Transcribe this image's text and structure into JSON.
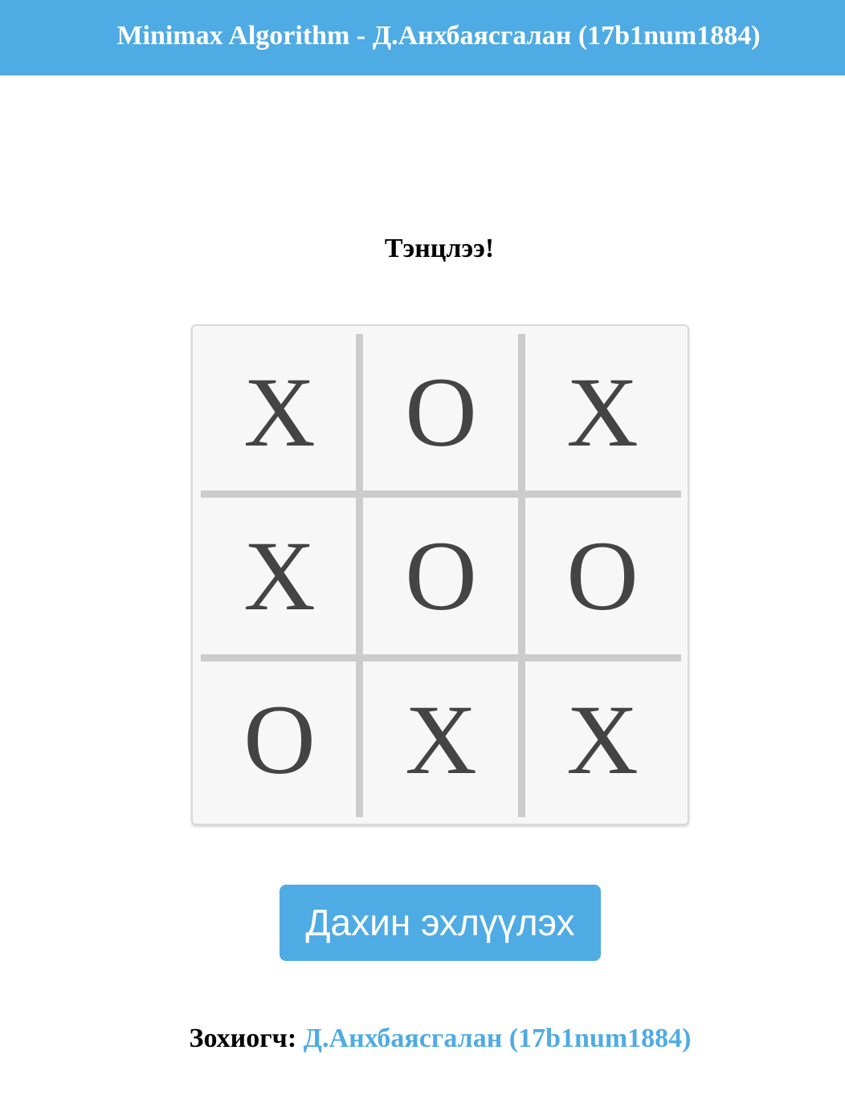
{
  "header": {
    "title": "Minimax Algorithm - Д.Анхбаясгалан (17b1num1884)",
    "background_color": "#4fabe3"
  },
  "game": {
    "status": "Тэнцлээ!",
    "board": [
      "X",
      "O",
      "X",
      "X",
      "O",
      "O",
      "O",
      "X",
      "X"
    ],
    "mark_color": "#444444",
    "grid_color": "#cccccc"
  },
  "restart_button": {
    "label": "Дахин эхлүүлэх",
    "color": "#4fabe3"
  },
  "footer": {
    "label": "Зохиогч:",
    "author_link": "Д.Анхбаясгалан (17b1num1884)",
    "link_color": "#4fabe3"
  }
}
